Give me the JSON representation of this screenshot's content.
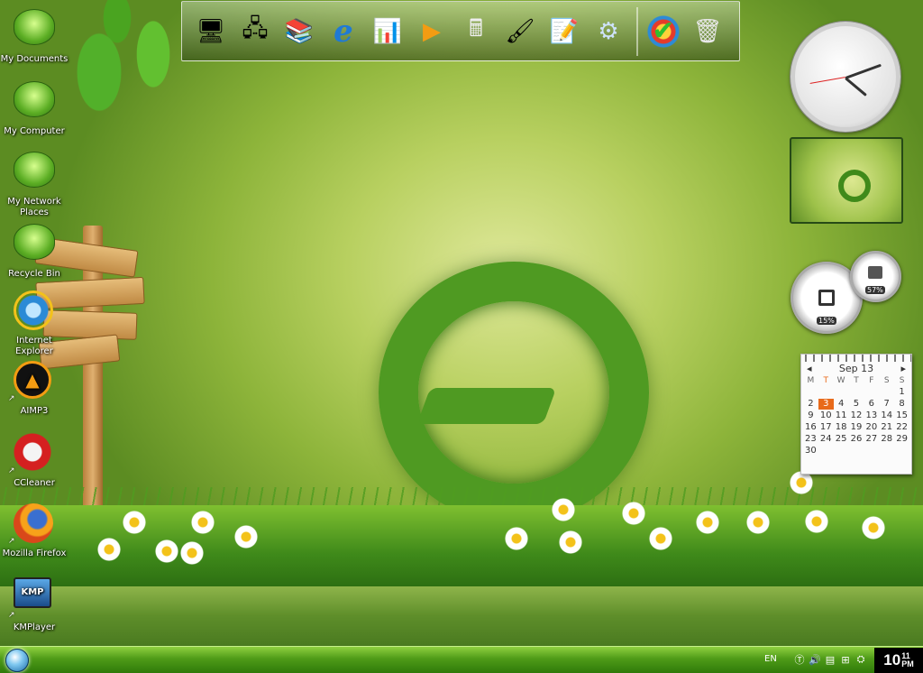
{
  "desktop_icons": [
    {
      "label": "My Documents",
      "icon": "folder-cup-icon"
    },
    {
      "label": "My Computer",
      "icon": "computer-flower-icon"
    },
    {
      "label": "My Network Places",
      "icon": "network-places-icon"
    },
    {
      "label": "Recycle Bin",
      "icon": "recycle-bin-icon"
    },
    {
      "label": "Internet Explorer",
      "icon": "internet-explorer-icon"
    },
    {
      "label": "AIMP3",
      "icon": "aimp-icon"
    },
    {
      "label": "CCleaner",
      "icon": "ccleaner-icon"
    },
    {
      "label": "Mozilla Firefox",
      "icon": "firefox-icon"
    },
    {
      "label": "KMPlayer",
      "icon": "kmplayer-icon"
    }
  ],
  "kmp_badge": "KMP",
  "dock": {
    "items": [
      {
        "name": "my-computer",
        "glyph": "🖥"
      },
      {
        "name": "network",
        "glyph": "🖧"
      },
      {
        "name": "documents",
        "glyph": "📚"
      },
      {
        "name": "internet-explorer",
        "glyph": "ℯ"
      },
      {
        "name": "presentation",
        "glyph": "📊"
      },
      {
        "name": "media-player",
        "glyph": "▶"
      },
      {
        "name": "calculator",
        "glyph": "🖩"
      },
      {
        "name": "paint-brushes",
        "glyph": "🖌"
      },
      {
        "name": "notepad",
        "glyph": "📝"
      },
      {
        "name": "control-panel",
        "glyph": "⚙"
      }
    ],
    "extra": [
      {
        "name": "windows-update",
        "glyph": "✔"
      },
      {
        "name": "recycle-bin",
        "glyph": "🗑"
      }
    ]
  },
  "gadgets": {
    "cpu_meter": {
      "cpu_percent": "15%",
      "memory_percent": "57%"
    },
    "calendar": {
      "month_label": "Sep 13",
      "weekdays": [
        "M",
        "T",
        "W",
        "T",
        "F",
        "S",
        "S"
      ],
      "today": "3",
      "days": [
        "",
        "",
        "",
        "",
        "",
        "",
        "1",
        "2",
        "3",
        "4",
        "5",
        "6",
        "7",
        "8",
        "9",
        "10",
        "11",
        "12",
        "13",
        "14",
        "15",
        "16",
        "17",
        "18",
        "19",
        "20",
        "21",
        "22",
        "23",
        "24",
        "25",
        "26",
        "27",
        "28",
        "29",
        "30",
        "",
        "",
        "",
        "",
        "",
        ""
      ]
    }
  },
  "taskbar": {
    "language": "EN",
    "time_hour": "10",
    "time_minute": "11",
    "time_ampm": "PM"
  },
  "colors": {
    "taskbar_green": "#4f9b18",
    "calendar_today": "#e86a1a"
  }
}
